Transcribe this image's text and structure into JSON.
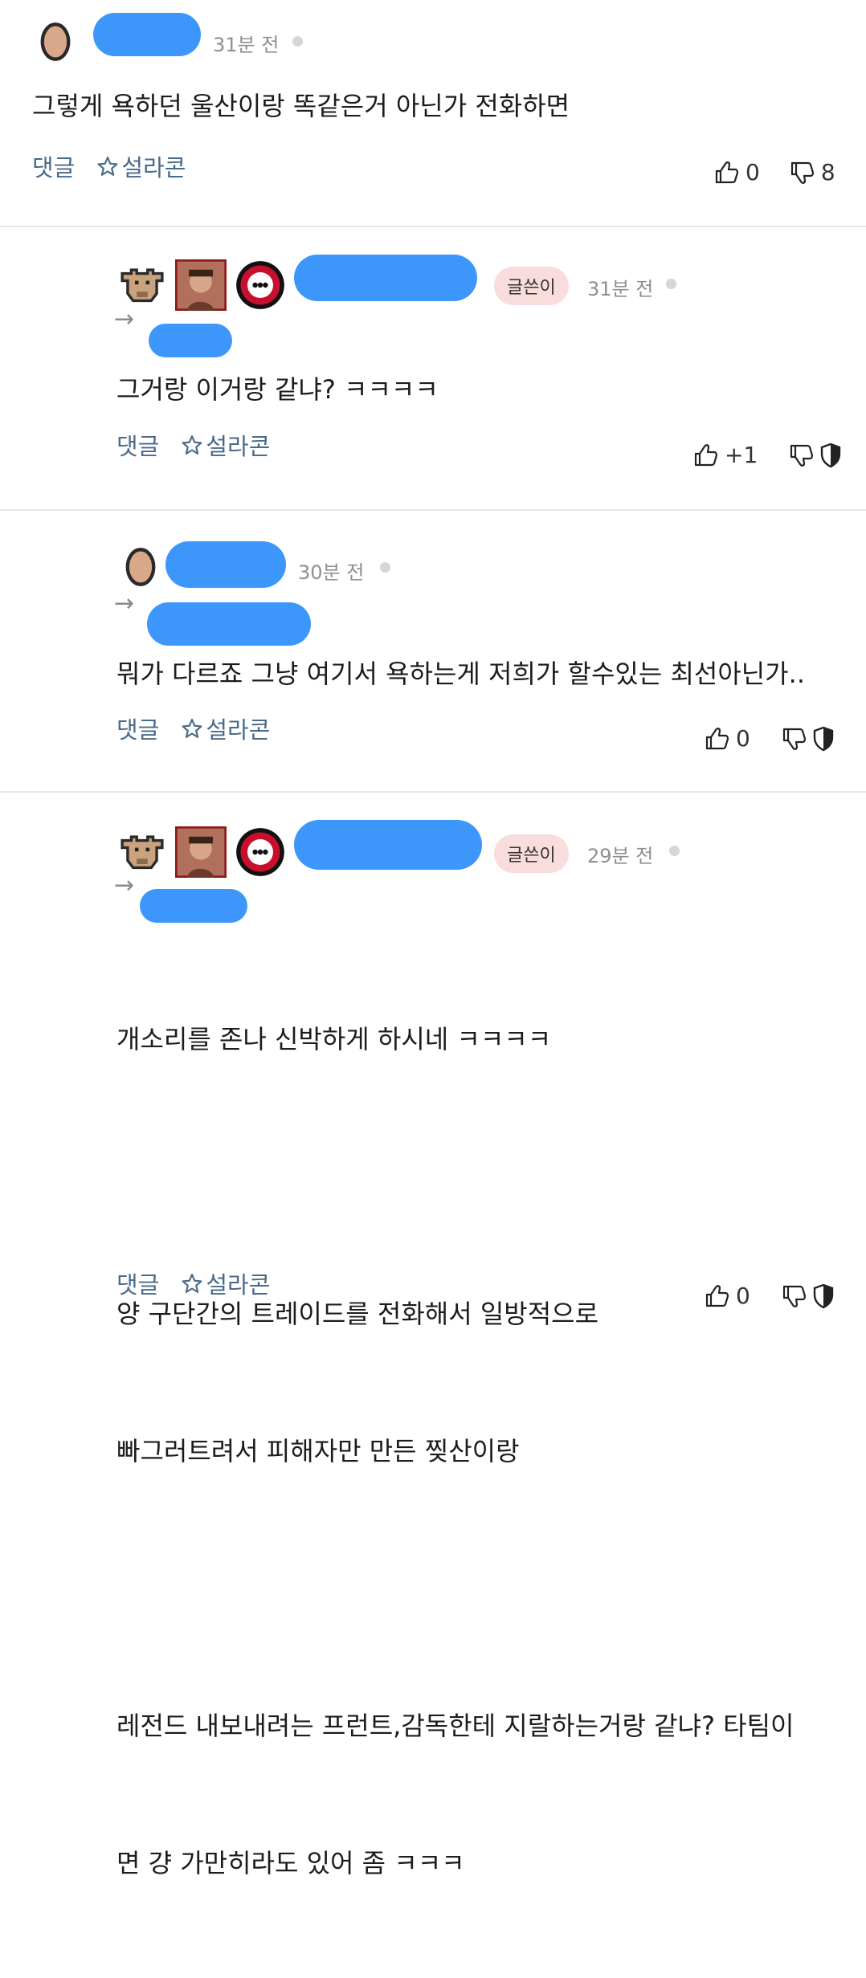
{
  "comments": [
    {
      "time": "31분 전",
      "text": "그렇게 욕하던 울산이랑 똑같은거 아닌가 전화하면",
      "reply_label": "댓글",
      "fav_label": "설라콘",
      "up_count": "0",
      "down_count": "8"
    },
    {
      "badge": "글쓴이",
      "time": "31분 전",
      "text": "그거랑 이거랑 같냐? ㅋㅋㅋㅋ",
      "reply_label": "댓글",
      "fav_label": "설라콘",
      "up_count": "+1"
    },
    {
      "time": "30분 전",
      "text": "뭐가 다르죠 그냥 여기서 욕하는게 저희가 할수있는 최선아닌가..",
      "reply_label": "댓글",
      "fav_label": "설라콘",
      "up_count": "0"
    },
    {
      "badge": "글쓴이",
      "time": "29분 전",
      "text_lines": [
        "개소리를 존나 신박하게 하시네 ㅋㅋㅋㅋ",
        "",
        "양 구단간의 트레이드를 전화해서 일방적으로",
        "빠그러트려서 피해자만 만든 찢산이랑",
        "",
        "레전드 내보내려는 프런트,감독한테 지랄하는거랑 같냐? 타팀이",
        "면 걍 가만히라도 있어 좀 ㅋㅋㅋ"
      ],
      "reply_label": "댓글",
      "fav_label": "설라콘",
      "up_count": "0"
    }
  ],
  "colors": {
    "redaction": "#3d97fb",
    "badge_bg": "#f9dcdc",
    "action_text": "#4a6a8a",
    "time_text": "#8f8f8f"
  },
  "icons": [
    "egg-avatar-icon",
    "bull-head-icon",
    "player-photo-icon",
    "club-emblem-icon",
    "arrow-right-icon",
    "star-outline-icon",
    "thumbs-up-icon",
    "thumbs-down-icon",
    "shield-icon"
  ]
}
